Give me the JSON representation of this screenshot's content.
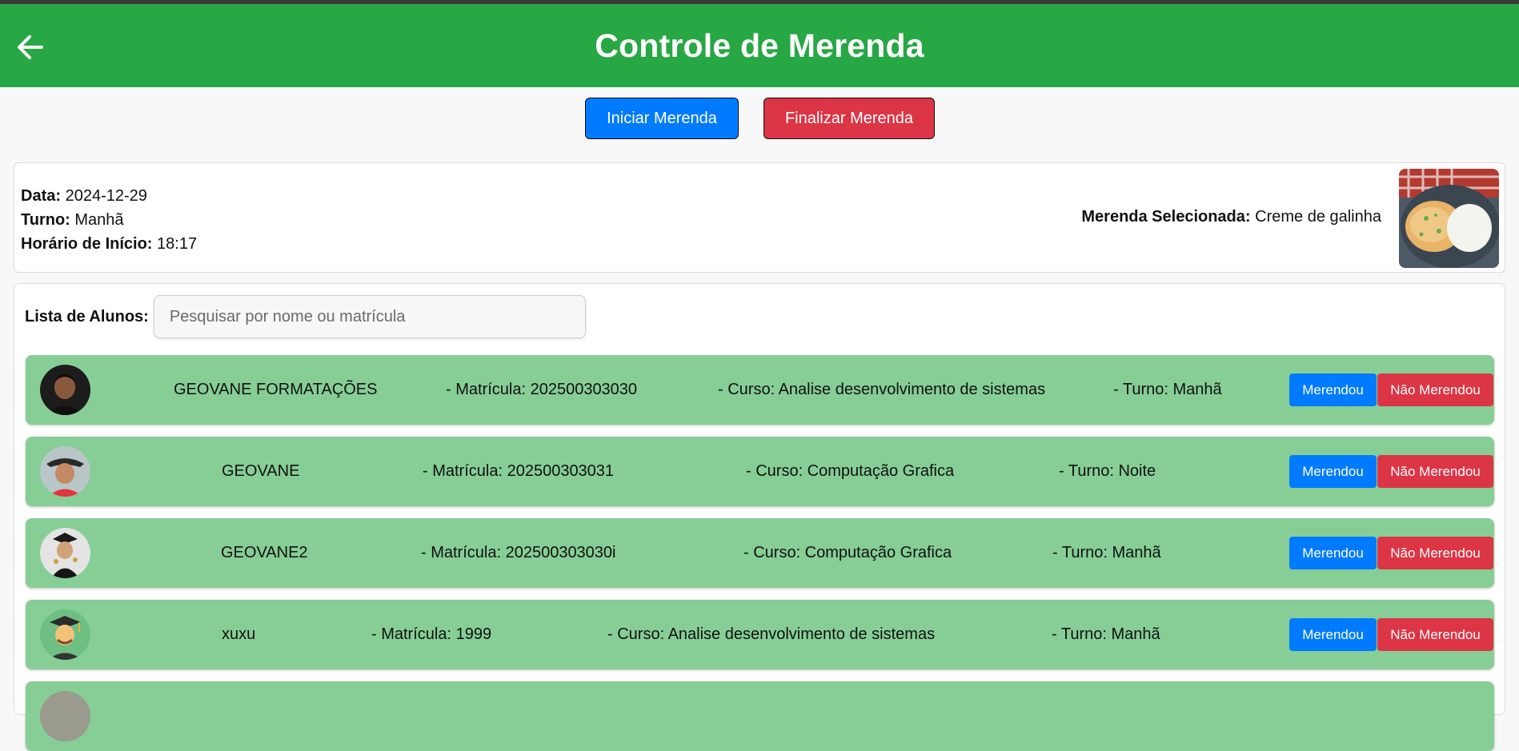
{
  "header": {
    "title": "Controle de Merenda"
  },
  "actions": {
    "start_label": "Iniciar Merenda",
    "end_label": "Finalizar Merenda"
  },
  "info": {
    "data_label": "Data:",
    "data_value": "2024-12-29",
    "turno_label": "Turno:",
    "turno_value": "Manhã",
    "inicio_label": "Horário de Início:",
    "inicio_value": "18:17",
    "merenda_label": "Merenda Selecionada:",
    "merenda_value": "Creme de galinha"
  },
  "list": {
    "label": "Lista de Alunos:",
    "search_placeholder": "Pesquisar por nome ou matrícula",
    "merendou_label": "Merendou",
    "nao_merendou_label": "Não Merendou",
    "students": [
      {
        "name": "GEOVANE FORMATAÇÕES",
        "matricula": "- Matrícula: 202500303030",
        "curso": "- Curso: Analise desenvolvimento de sistemas",
        "turno": "- Turno: Manhã"
      },
      {
        "name": "GEOVANE",
        "matricula": "- Matrícula: 202500303031",
        "curso": "- Curso: Computação Grafica",
        "turno": "- Turno: Noite"
      },
      {
        "name": "GEOVANE2",
        "matricula": "- Matrícula: 202500303030i",
        "curso": "- Curso: Computação Grafica",
        "turno": "- Turno: Manhã"
      },
      {
        "name": "xuxu",
        "matricula": "- Matrícula: 1999",
        "curso": "- Curso: Analise desenvolvimento de sistemas",
        "turno": "- Turno: Manhã"
      }
    ]
  },
  "colors": {
    "header": "#28a745",
    "row": "#86ce95",
    "primary": "#007bff",
    "danger": "#dc3545"
  },
  "icons": {
    "back": "arrow-left-icon"
  }
}
